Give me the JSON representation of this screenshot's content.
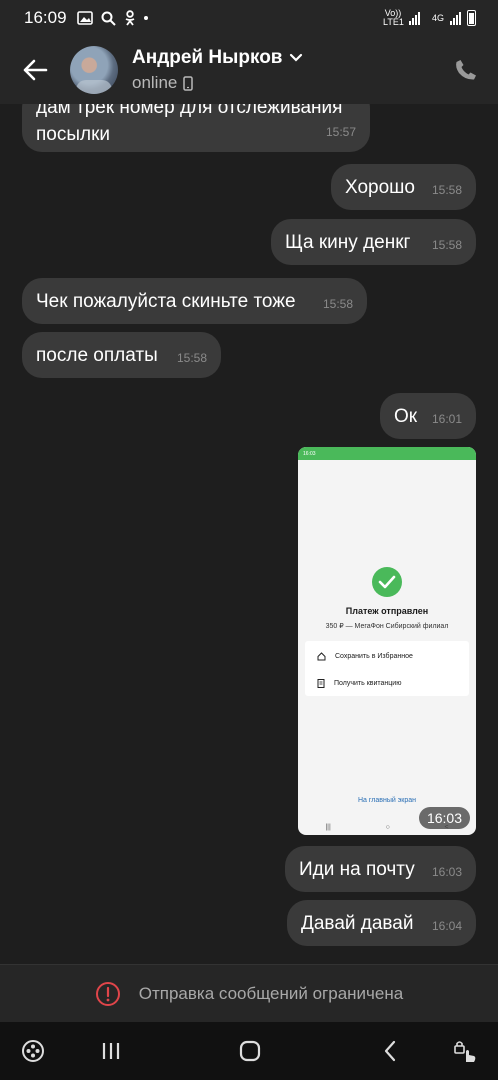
{
  "status_bar": {
    "time": "16:09",
    "network_1": "Vo)) LTE1",
    "network_2": "4G"
  },
  "header": {
    "contact_name": "Андрей Нырков",
    "status": "online"
  },
  "messages": [
    {
      "text": "дам трек номер для отслеживания посылки",
      "time": "15:57",
      "side": "incoming"
    },
    {
      "text": "Хорошо",
      "time": "15:58",
      "side": "outgoing"
    },
    {
      "text": "Ща кину денкг",
      "time": "15:58",
      "side": "outgoing"
    },
    {
      "text": "Чек пожалуйста скиньте тоже",
      "time": "15:58",
      "side": "incoming"
    },
    {
      "text": "после оплаты",
      "time": "15:58",
      "side": "incoming"
    },
    {
      "text": "Ок",
      "time": "16:01",
      "side": "outgoing"
    },
    {
      "text": "Иди на почту",
      "time": "16:03",
      "side": "outgoing"
    },
    {
      "text": "Давай давай",
      "time": "16:04",
      "side": "outgoing"
    }
  ],
  "image_message": {
    "time": "16:03",
    "status_time": "16:03",
    "title": "Платеж отправлен",
    "subtitle": "350 ₽ — МегаФон Сибирский филиал",
    "actions": [
      "Сохранить в Избранное",
      "Получить квитанцию"
    ],
    "home_link": "На главный экран"
  },
  "restricted_notice": "Отправка сообщений ограничена",
  "colors": {
    "background": "#1e1e1e",
    "bubble": "#3a3a3a",
    "header": "#262626",
    "accent_green": "#4ab95a",
    "warning_red": "#e0454a"
  }
}
